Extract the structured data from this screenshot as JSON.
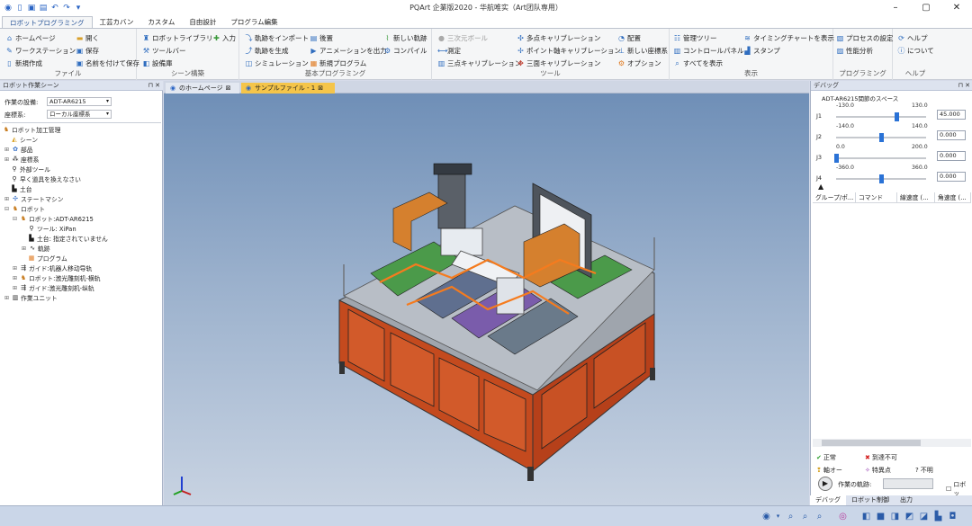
{
  "window": {
    "title": "PQArt 企業版2020 - 华航唯实（Art团队専用）"
  },
  "tabs": [
    "ロボットプログラミング",
    "工芸カバン",
    "カスタム",
    "自由設計",
    "プログラム編集"
  ],
  "ribbon": {
    "file": {
      "label": "ファイル",
      "items": [
        "ホームページ",
        "開く",
        "ワークステーション",
        "保存",
        "新規作成",
        "名前を付けて保存"
      ]
    },
    "scene": {
      "label": "シーン構築",
      "items": [
        "ロボットライブラリ",
        "入力",
        "ツールバー",
        "設備庫"
      ]
    },
    "basic": {
      "label": "基本プログラミング",
      "items": [
        "軌跡をインポート",
        "後置",
        "新しい軌跡",
        "軌跡を生成",
        "アニメーションを出力",
        "コンパイル",
        "シミュレーション",
        "新規プログラム"
      ]
    },
    "tools": {
      "label": "ツール",
      "items": [
        "三次元ボール",
        "多点キャリブレーション",
        "配置",
        "測定",
        "ポイント軸キャリブレーション",
        "新しい座標系",
        "三点キャリブレーション",
        "三面キャリブレーション",
        "オプション"
      ]
    },
    "display": {
      "label": "表示",
      "items": [
        "管理ツリー",
        "タイミングチャートを表示",
        "コントロールパネル",
        "スタンプ",
        "すべてを表示"
      ]
    },
    "programming": {
      "label": "プログラミング",
      "items": [
        "プロセスの設定",
        "性能分析"
      ]
    },
    "help": {
      "label": "ヘルプ",
      "items": [
        "ヘルプ",
        "について"
      ]
    }
  },
  "left_panel": {
    "title": "ロボット作業シーン",
    "workstation_label": "作業の設備:",
    "workstation_value": "ADT-AR6215",
    "coord_label": "座標系:",
    "coord_value": "ローカル座標系",
    "tree": [
      "ロボット加工管理",
      "シーン",
      "部品",
      "座標系",
      "外部ツール",
      "早く道具を換えなさい",
      "土台",
      "ステートマシン",
      "ロボット",
      "ロボット:ADT-AR6215",
      "ツール: XiPan",
      "土台: 指定されていません",
      "軌跡",
      "プログラム",
      "ガイド:机器人移动导轨",
      "ロボット:激光雕刻机-横轨",
      "ガイド:激光雕刻机-纵轨",
      "作業ユニット"
    ]
  },
  "doc_tabs": [
    "のホームページ",
    "サンプルファイル - 1"
  ],
  "debug_panel": {
    "title": "デバッグ",
    "robot_name": "ADT-AR6215関節のスペース",
    "joints": [
      {
        "name": "J1",
        "min": "-130.0",
        "max": "130.0",
        "value": "45.000",
        "fraction": 0.673
      },
      {
        "name": "J2",
        "min": "-140.0",
        "max": "140.0",
        "value": "0.000",
        "fraction": 0.5
      },
      {
        "name": "J3",
        "min": "0.0",
        "max": "200.0",
        "value": "0.000",
        "fraction": 0.0
      },
      {
        "name": "J4",
        "min": "-360.0",
        "max": "360.0",
        "value": "0.000",
        "fraction": 0.5
      }
    ],
    "columns": [
      "グループ/ポ...",
      "コマンド",
      "線速度 (...",
      "角速度 (..."
    ],
    "legend": [
      "正常",
      "到達不可",
      "軸オー",
      "特異点",
      "不明"
    ],
    "trajectory_label": "作業の軌跡:",
    "robot_check": "ロボッ"
  },
  "bottom_tabs": [
    "デバッグ",
    "ロボット制御",
    "出力"
  ],
  "colors": {
    "accent": "#2b579a",
    "selected_tab": "#f5c54a",
    "frame": "#d04a1e"
  }
}
